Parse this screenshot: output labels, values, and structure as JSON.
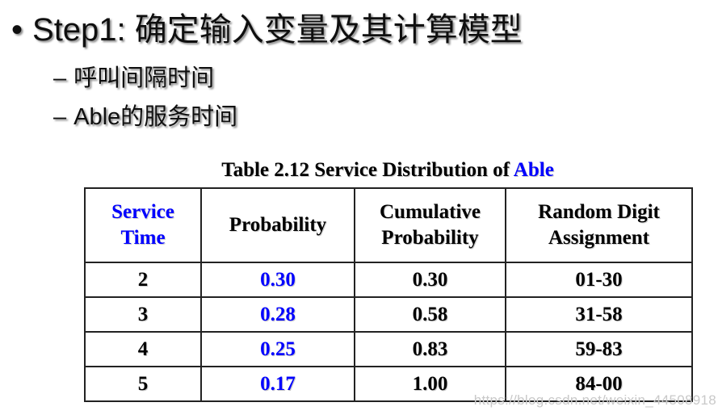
{
  "slide": {
    "background_color": "#ffffff",
    "accent_color": "#0000ff",
    "text_color": "#0f0f0f"
  },
  "outline": {
    "level1": {
      "marker": "•",
      "text": "Step1: 确定输入变量及其计算模型"
    },
    "level2": [
      {
        "marker": "–",
        "text": "呼叫间隔时间"
      },
      {
        "marker": "–",
        "text": "Able的服务时间"
      }
    ]
  },
  "table": {
    "title_prefix": "Table 2.12 Service Distribution of ",
    "title_accent": "Able",
    "headers": [
      {
        "line1": "Service",
        "line2": "Time",
        "accent": true
      },
      {
        "line1": "Probability",
        "line2": "",
        "accent": false
      },
      {
        "line1": "Cumulative",
        "line2": "Probability",
        "accent": false
      },
      {
        "line1": "Random Digit",
        "line2": "Assignment",
        "accent": false
      }
    ],
    "rows": [
      {
        "service_time": "2",
        "probability": "0.30",
        "cumulative": "0.30",
        "random_digits": "01-30"
      },
      {
        "service_time": "3",
        "probability": "0.28",
        "cumulative": "0.58",
        "random_digits": "31-58"
      },
      {
        "service_time": "4",
        "probability": "0.25",
        "cumulative": "0.83",
        "random_digits": "59-83"
      },
      {
        "service_time": "5",
        "probability": "0.17",
        "cumulative": "1.00",
        "random_digits": "84-00"
      }
    ]
  },
  "watermark": {
    "text": "https://blog.csdn.net/weixin_44508918"
  }
}
